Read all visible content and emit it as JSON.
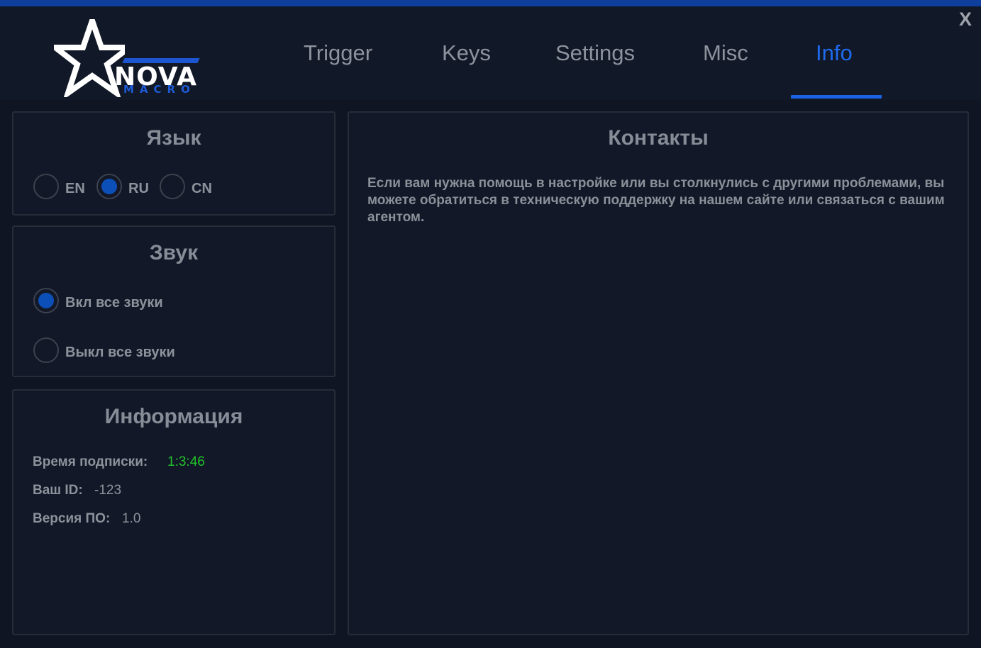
{
  "window": {
    "close_label": "X",
    "accent_color": "#1e6bf0",
    "selected_radio_color": "#0d4fb8",
    "highlight_value_color": "#22c22b"
  },
  "logo": {
    "word": "NOVA",
    "sub": "MACRO",
    "icon": "star-icon"
  },
  "tabs": [
    {
      "label": "Trigger",
      "active": false
    },
    {
      "label": "Keys",
      "active": false
    },
    {
      "label": "Settings",
      "active": false
    },
    {
      "label": "Misc",
      "active": false
    },
    {
      "label": "Info",
      "active": true
    }
  ],
  "language": {
    "title": "Язык",
    "options": [
      {
        "label": "EN",
        "selected": false
      },
      {
        "label": "RU",
        "selected": true
      },
      {
        "label": "CN",
        "selected": false
      }
    ]
  },
  "sound": {
    "title": "Звук",
    "options": [
      {
        "label": "Вкл все звуки",
        "selected": true
      },
      {
        "label": "Выкл все звуки",
        "selected": false
      }
    ]
  },
  "information": {
    "title": "Информация",
    "rows": [
      {
        "label": "Время подписки:",
        "value": "1:3:46"
      },
      {
        "label": "Ваш ID:",
        "value": "-123"
      },
      {
        "label": "Версия ПО:",
        "value": "1.0"
      }
    ]
  },
  "contacts": {
    "title": "Контакты",
    "text": "Если вам нужна помощь в настройке или вы столкнулись с другими проблемами, вы можете обратиться в техническую поддержку на нашем сайте или связаться с вашим агентом."
  }
}
